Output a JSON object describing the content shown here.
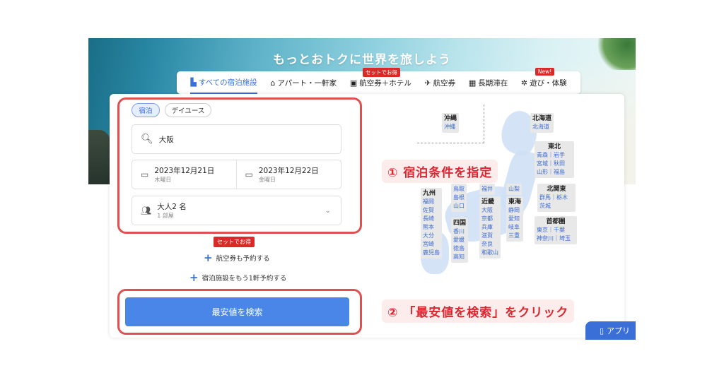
{
  "banner": {
    "title": "もっとおトクに世界を旅しよう"
  },
  "tabs": [
    {
      "label": "すべての宿泊施設",
      "icon": "building-icon"
    },
    {
      "label": "アパート・一軒家",
      "icon": "house-icon"
    },
    {
      "label": "航空券＋ホテル",
      "icon": "suitcase-icon",
      "badge": "セットでお得"
    },
    {
      "label": "航空券",
      "icon": "airplane-icon"
    },
    {
      "label": "長期滞在",
      "icon": "calendar-icon"
    },
    {
      "label": "遊び・体験",
      "icon": "ferris-wheel-icon",
      "badge": "New!"
    }
  ],
  "stay_type": {
    "options": [
      "宿泊",
      "デイユース"
    ],
    "selected": "宿泊"
  },
  "search": {
    "destination": "大阪"
  },
  "dates": {
    "checkin": {
      "date": "2023年12月21日",
      "weekday": "木曜日"
    },
    "checkout": {
      "date": "2023年12月22日",
      "weekday": "金曜日"
    }
  },
  "guests": {
    "main": "大人2 名",
    "sub": "1 部屋"
  },
  "bundle_badge": "セットでお得",
  "links": {
    "add_flight": "航空券も予約する",
    "add_stay": "宿泊施設をもう1軒予約する"
  },
  "search_button": "最安値を検索",
  "callouts": {
    "step1": "① 宿泊条件を指定",
    "step2": "② 「最安値を検索」をクリック"
  },
  "app_button": "アプリ",
  "map": {
    "okinawa": {
      "name": "沖縄",
      "items": [
        "沖縄"
      ]
    },
    "hokkaido": {
      "name": "北海道",
      "items": [
        "北海道"
      ]
    },
    "tohoku": {
      "name": "東北",
      "items": [
        "青森｜岩手",
        "宮城｜秋田",
        "山形｜福島"
      ]
    },
    "kitakanto": {
      "name": "北関東",
      "items": [
        "群馬｜栃木",
        "茨城"
      ]
    },
    "shutoken": {
      "name": "首都圏",
      "items": [
        "東京｜千葉",
        "神奈川｜埼玉"
      ]
    },
    "tokai": {
      "name": "東海",
      "items": [
        "静岡",
        "愛知",
        "岐阜",
        "三重"
      ]
    },
    "kinki": {
      "name": "近畿",
      "items": [
        "大阪",
        "京都",
        "兵庫",
        "滋賀",
        "奈良",
        "和歌山"
      ]
    },
    "kyushu": {
      "name": "九州",
      "items": [
        "福岡",
        "佐賀",
        "長崎",
        "熊本",
        "大分",
        "宮崎",
        "鹿児島"
      ]
    },
    "shikoku": {
      "name": "四国",
      "items": [
        "香川",
        "愛媛",
        "徳島",
        "高知"
      ]
    },
    "chugoku": {
      "items": [
        "鳥取",
        "島根",
        "山口"
      ]
    },
    "hokuriku": {
      "items": [
        "福井"
      ]
    },
    "koshinetsu": {
      "items": [
        "山梨"
      ]
    }
  }
}
